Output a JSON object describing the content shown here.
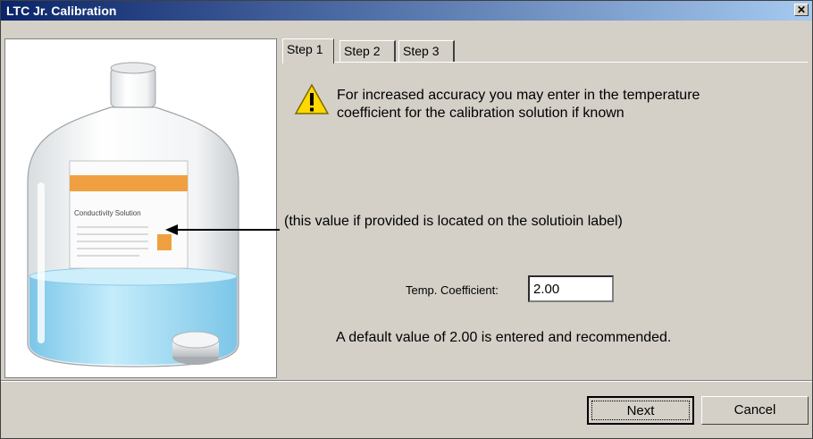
{
  "window": {
    "title": "LTC Jr. Calibration",
    "close_glyph": "✕"
  },
  "illustration": {
    "bottle_label_text": "Conductivity Solution"
  },
  "tabs": [
    {
      "label": "Step 1",
      "active": true
    },
    {
      "label": "Step 2",
      "active": false
    },
    {
      "label": "Step 3",
      "active": false
    }
  ],
  "step1": {
    "message": "For increased accuracy you may enter in the temperature coefficient for the calibration solution if known",
    "hint": "(this value if provided is located on the solutioin label)",
    "temp_coefficient_label": "Temp. Coefficient:",
    "temp_coefficient_value": "2.00",
    "default_note": "A default value of 2.00 is entered and recommended."
  },
  "buttons": {
    "next": "Next",
    "cancel": "Cancel"
  },
  "colors": {
    "title_gradient_start": "#0a246a",
    "title_gradient_end": "#a6caf0",
    "dialog_face": "#d4d0c8",
    "label_orange": "#f0a040",
    "liquid_blue": "#9fd8f0"
  }
}
